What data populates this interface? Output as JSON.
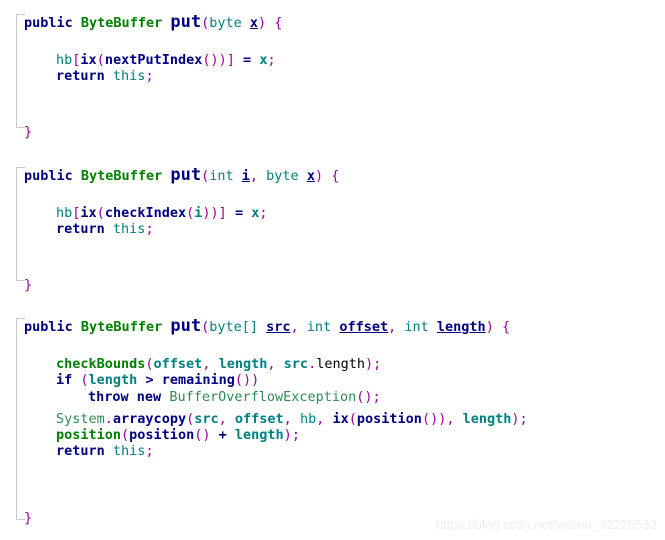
{
  "editor": {
    "language": "java",
    "background_color": "#ffffff",
    "theme_colors": {
      "keyword": "#000080",
      "type": "#008000",
      "class": "#2e8b57",
      "punctuation": "#990099",
      "primitive": "#008080",
      "field": "#008080",
      "text": "#000000",
      "fold_line": "#c8c8c8",
      "watermark": "#eeeeee"
    }
  },
  "watermark": {
    "text": "https://blog.csdn.net/weixin_42220532"
  },
  "methods": [
    {
      "name": "put",
      "signature_parts": {
        "modifier": "public",
        "return_type": "ByteBuffer",
        "method_name": "put",
        "params": "(byte x) {"
      },
      "body_lines": [
        "hb[ix(nextPutIndex())] = x;",
        "return this;"
      ],
      "closing_brace": "}"
    },
    {
      "name": "put",
      "signature_parts": {
        "modifier": "public",
        "return_type": "ByteBuffer",
        "method_name": "put",
        "params": "(int i, byte x) {"
      },
      "body_lines": [
        "hb[ix(checkIndex(i))] = x;",
        "return this;"
      ],
      "closing_brace": "}"
    },
    {
      "name": "put",
      "signature_parts": {
        "modifier": "public",
        "return_type": "ByteBuffer",
        "method_name": "put",
        "params": "(byte[] src, int offset, int length) {"
      },
      "body_lines": [
        "checkBounds(offset, length, src.length);",
        "if (length > remaining())",
        "    throw new BufferOverflowException();",
        "System.arraycopy(src, offset, hb, ix(position()), length);",
        "position(position() + length);",
        "return this;"
      ],
      "closing_brace": "}"
    }
  ],
  "tokens": {
    "kw_public": "public",
    "type_bytebuffer": "ByteBuffer",
    "name_put": "put",
    "open_paren": "(",
    "close_paren": ")",
    "open_bracket": "[",
    "close_bracket": "]",
    "semicolon": ";",
    "comma": ",",
    "dot": ".",
    "brace_open": "{",
    "brace_close": "}",
    "prim_byte": "byte",
    "prim_byte_array": "byte[]",
    "prim_int": "int",
    "param_x": "x",
    "param_i": "i",
    "param_src": "src",
    "param_offset": "offset",
    "param_length": "length",
    "field_hb": "hb",
    "kw_return": "return",
    "kw_this": "this",
    "kw_if": "if",
    "kw_throw": "throw",
    "kw_new": "new",
    "m_ix": "ix",
    "m_nextPutIndex": "nextPutIndex",
    "m_checkIndex": "checkIndex",
    "m_checkBounds": "checkBounds",
    "m_remaining": "remaining",
    "m_arraycopy": "arraycopy",
    "m_position": "position",
    "cls_system": "System",
    "cls_bufferoverflow": "BufferOverflowException",
    "op_assign": "=",
    "op_gt": ">",
    "op_plus": "+",
    "empty_parens": "()"
  }
}
